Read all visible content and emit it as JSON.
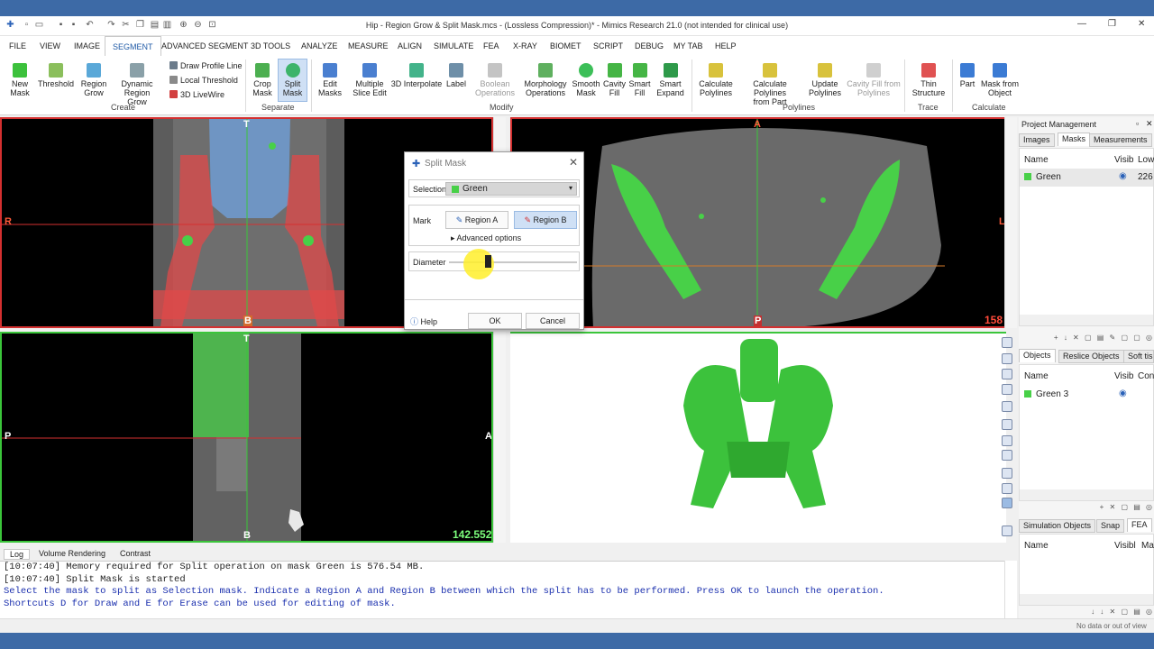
{
  "window": {
    "title": "Hip - Region Grow & Split Mask.mcs - (Lossless Compression)* - Mimics Research 21.0 (not intended for clinical use)"
  },
  "menu": [
    "FILE",
    "VIEW",
    "IMAGE",
    "SEGMENT",
    "ADVANCED SEGMENT",
    "3D TOOLS",
    "ANALYZE",
    "MEASURE",
    "ALIGN",
    "SIMULATE",
    "FEA",
    "X-RAY",
    "BIOMET",
    "SCRIPT",
    "DEBUG",
    "MY TAB",
    "HELP"
  ],
  "ribbon": {
    "buttons": [
      {
        "l1": "New",
        "l2": "Mask"
      },
      {
        "l1": "Threshold",
        "l2": ""
      },
      {
        "l1": "Region",
        "l2": "Grow"
      },
      {
        "l1": "Dynamic Region",
        "l2": "Grow"
      },
      {
        "l1": "Crop",
        "l2": "Mask"
      },
      {
        "l1": "Split",
        "l2": "Mask"
      },
      {
        "l1": "Edit",
        "l2": "Masks"
      },
      {
        "l1": "Multiple",
        "l2": "Slice Edit"
      },
      {
        "l1": "3D Interpolate",
        "l2": ""
      },
      {
        "l1": "Label",
        "l2": ""
      },
      {
        "l1": "Boolean",
        "l2": "Operations"
      },
      {
        "l1": "Morphology",
        "l2": "Operations"
      },
      {
        "l1": "Smooth",
        "l2": "Mask"
      },
      {
        "l1": "Cavity",
        "l2": "Fill"
      },
      {
        "l1": "Smart",
        "l2": "Fill"
      },
      {
        "l1": "Smart",
        "l2": "Expand"
      },
      {
        "l1": "Calculate",
        "l2": "Polylines"
      },
      {
        "l1": "Calculate Polylines",
        "l2": "from Part"
      },
      {
        "l1": "Update",
        "l2": "Polylines"
      },
      {
        "l1": "Cavity Fill from",
        "l2": "Polylines"
      },
      {
        "l1": "Thin",
        "l2": "Structure"
      },
      {
        "l1": "Part",
        "l2": ""
      },
      {
        "l1": "Mask from",
        "l2": "Object"
      }
    ],
    "small": [
      "Draw Profile Line",
      "Local Threshold",
      "3D LiveWire"
    ],
    "groups": [
      "Create",
      "Separate",
      "Modify",
      "Polylines",
      "Trace",
      "Calculate"
    ]
  },
  "viewports": {
    "coronal": {
      "top": "T",
      "bottom": "B",
      "left": "R"
    },
    "axial": {
      "top": "A",
      "bottom": "P",
      "right": "L",
      "value": "158"
    },
    "sagittal": {
      "top": "T",
      "bottom": "B",
      "left": "P",
      "right": "A",
      "value": "142.552"
    }
  },
  "dialog": {
    "title": "Split Mask",
    "selection_label": "Selection",
    "selection_value": "Green",
    "mark_label": "Mark",
    "region_a": "Region A",
    "region_b": "Region B",
    "advanced": "Advanced options",
    "diameter_label": "Diameter",
    "help": "Help",
    "ok": "OK",
    "cancel": "Cancel"
  },
  "log": {
    "tabs": [
      "Log",
      "Volume Rendering",
      "Contrast"
    ],
    "lines": [
      "[10:07:40] Memory required for Split operation on mask Green is 576.54 MB.",
      "[10:07:40] Split Mask is started",
      "Select the mask to split as Selection mask. Indicate a Region A and Region B between which the split has to be performed. Press OK to launch the operation.",
      "Shortcuts D for Draw and E for Erase can be used for editing of mask."
    ]
  },
  "project": {
    "title": "Project Management",
    "tabs1": [
      "Images",
      "Masks",
      "Measurements"
    ],
    "masks_cols": [
      "Name",
      "Visib",
      "Low"
    ],
    "mask_row": {
      "name": "Green",
      "low": "226"
    },
    "tabs2": [
      "Objects",
      "Reslice Objects",
      "Soft tis"
    ],
    "objects_cols": [
      "Name",
      "Visib",
      "Con"
    ],
    "object_row": {
      "name": "Green 3"
    },
    "tabs3": [
      "Simulation Objects",
      "Snap",
      "FEA"
    ],
    "sim_cols": [
      "Name",
      "Visibl",
      "Ma"
    ]
  },
  "status": {
    "text": "No data or out of view"
  },
  "colors": {
    "mask_green": "#48d048",
    "accent": "#1f5aa6",
    "title_blue": "#3d6aa6"
  }
}
